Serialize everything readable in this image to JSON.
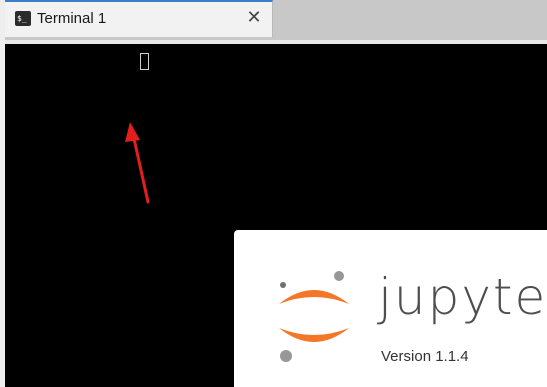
{
  "tab": {
    "title": "Terminal 1",
    "icon": "terminal-icon",
    "icon_glyph": "$_",
    "close_glyph": "✕",
    "accent_color": "#3c7ec8"
  },
  "terminal": {
    "background": "#000000"
  },
  "annotation": {
    "arrow_color": "#e31e1e"
  },
  "about": {
    "product_name": "jupyter",
    "version_text": "Version 1.1.4",
    "logo_orange": "#f37726",
    "logo_gray": "#989798"
  }
}
